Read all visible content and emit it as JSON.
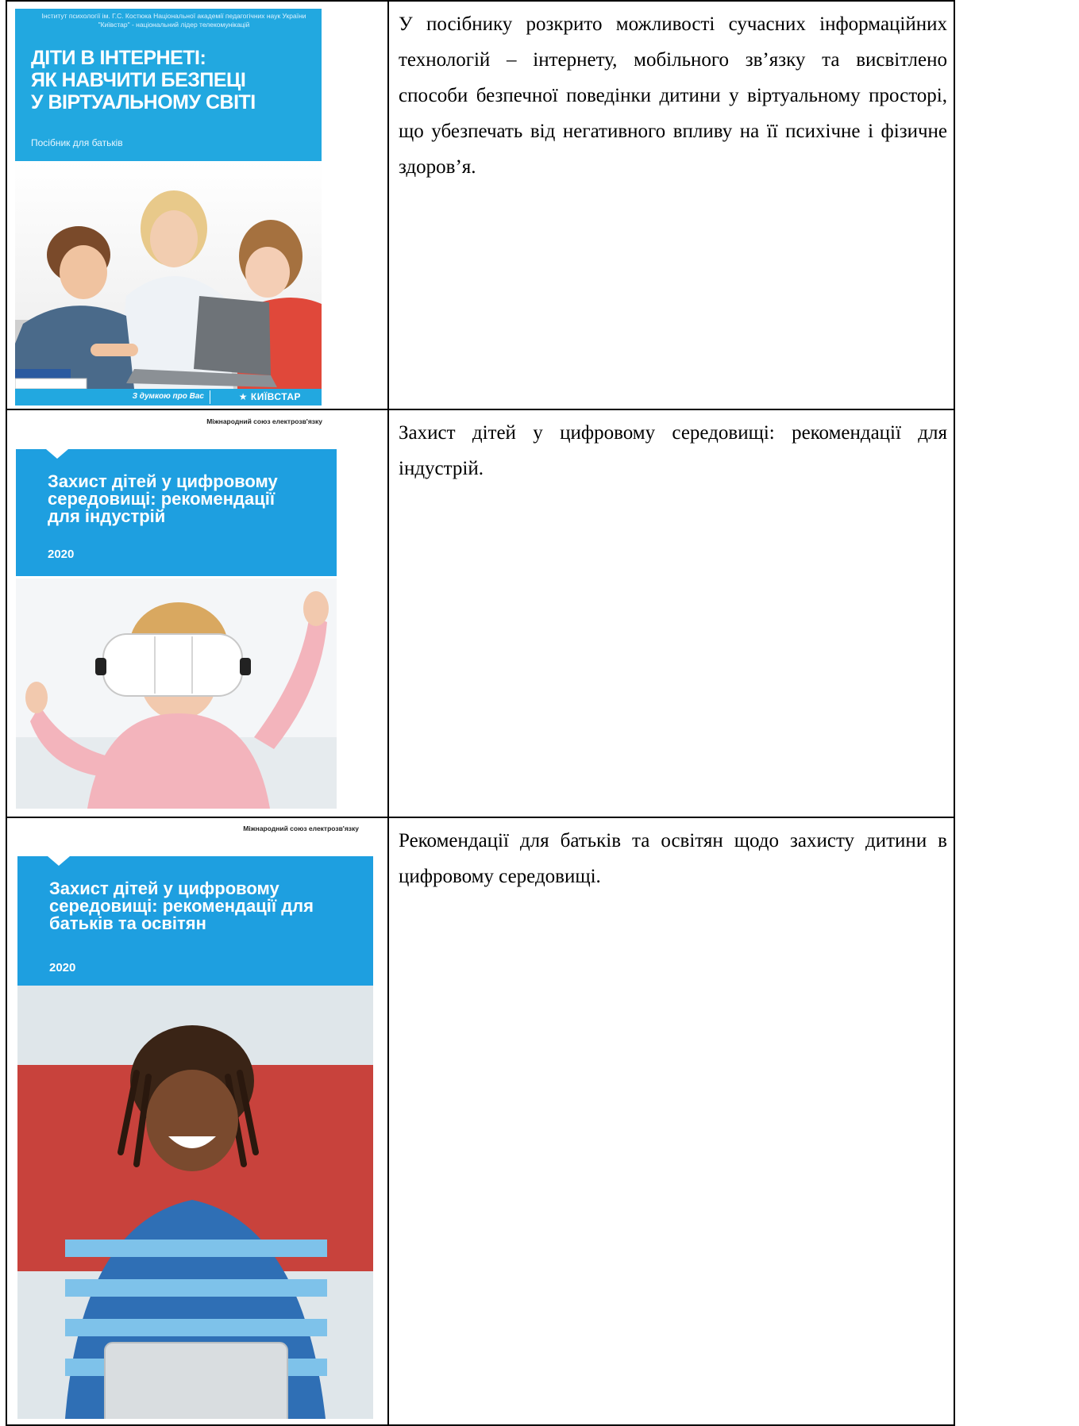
{
  "rows": [
    {
      "cover": {
        "institute_line1": "Інститут психології ім. Г.С. Костюка Національної академії педагогічних наук України",
        "institute_line2": "\"Київстар\" - національний лідер телекомунікацій",
        "title_line1": "ДІТИ В ІНТЕРНЕТІ:",
        "title_line2": "ЯК НАВЧИТИ БЕЗПЕЦІ",
        "title_line3": "У ВІРТУАЛЬНОМУ СВІТІ",
        "subtitle": "Посібник для батьків",
        "slogan": "З думкою про Вас",
        "brand": "КИЇВСТАР"
      },
      "description": "У посібнику розкрито можливості сучасних інформаційних технологій – інтернету, мобільного зв’язку та висвітлено способи безпечної поведінки дитини у віртуальному просторі, що убезпечать від негативного впливу на її психічне і фізичне здоров’я."
    },
    {
      "cover": {
        "org": "Міжнародний союз електрозв'язку",
        "title_line1": "Захист дітей у цифровому",
        "title_line2": "середовищі: рекомендації",
        "title_line3": "для індустрій",
        "year": "2020"
      },
      "description": "Захист дітей у цифровому середовищі: рекомендації для індустрій."
    },
    {
      "cover": {
        "org": "Міжнародний союз електрозв'язку",
        "title_line1": "Захист дітей у цифровому",
        "title_line2": "середовищі: рекомендації для",
        "title_line3": "батьків та освітян",
        "year": "2020"
      },
      "description": "Рекомендації для батьків та освітян щодо захисту дитини в цифровому середовищі."
    }
  ],
  "colors": {
    "kyivstar_blue": "#22a8e0",
    "itu_blue": "#1e9fe0"
  }
}
